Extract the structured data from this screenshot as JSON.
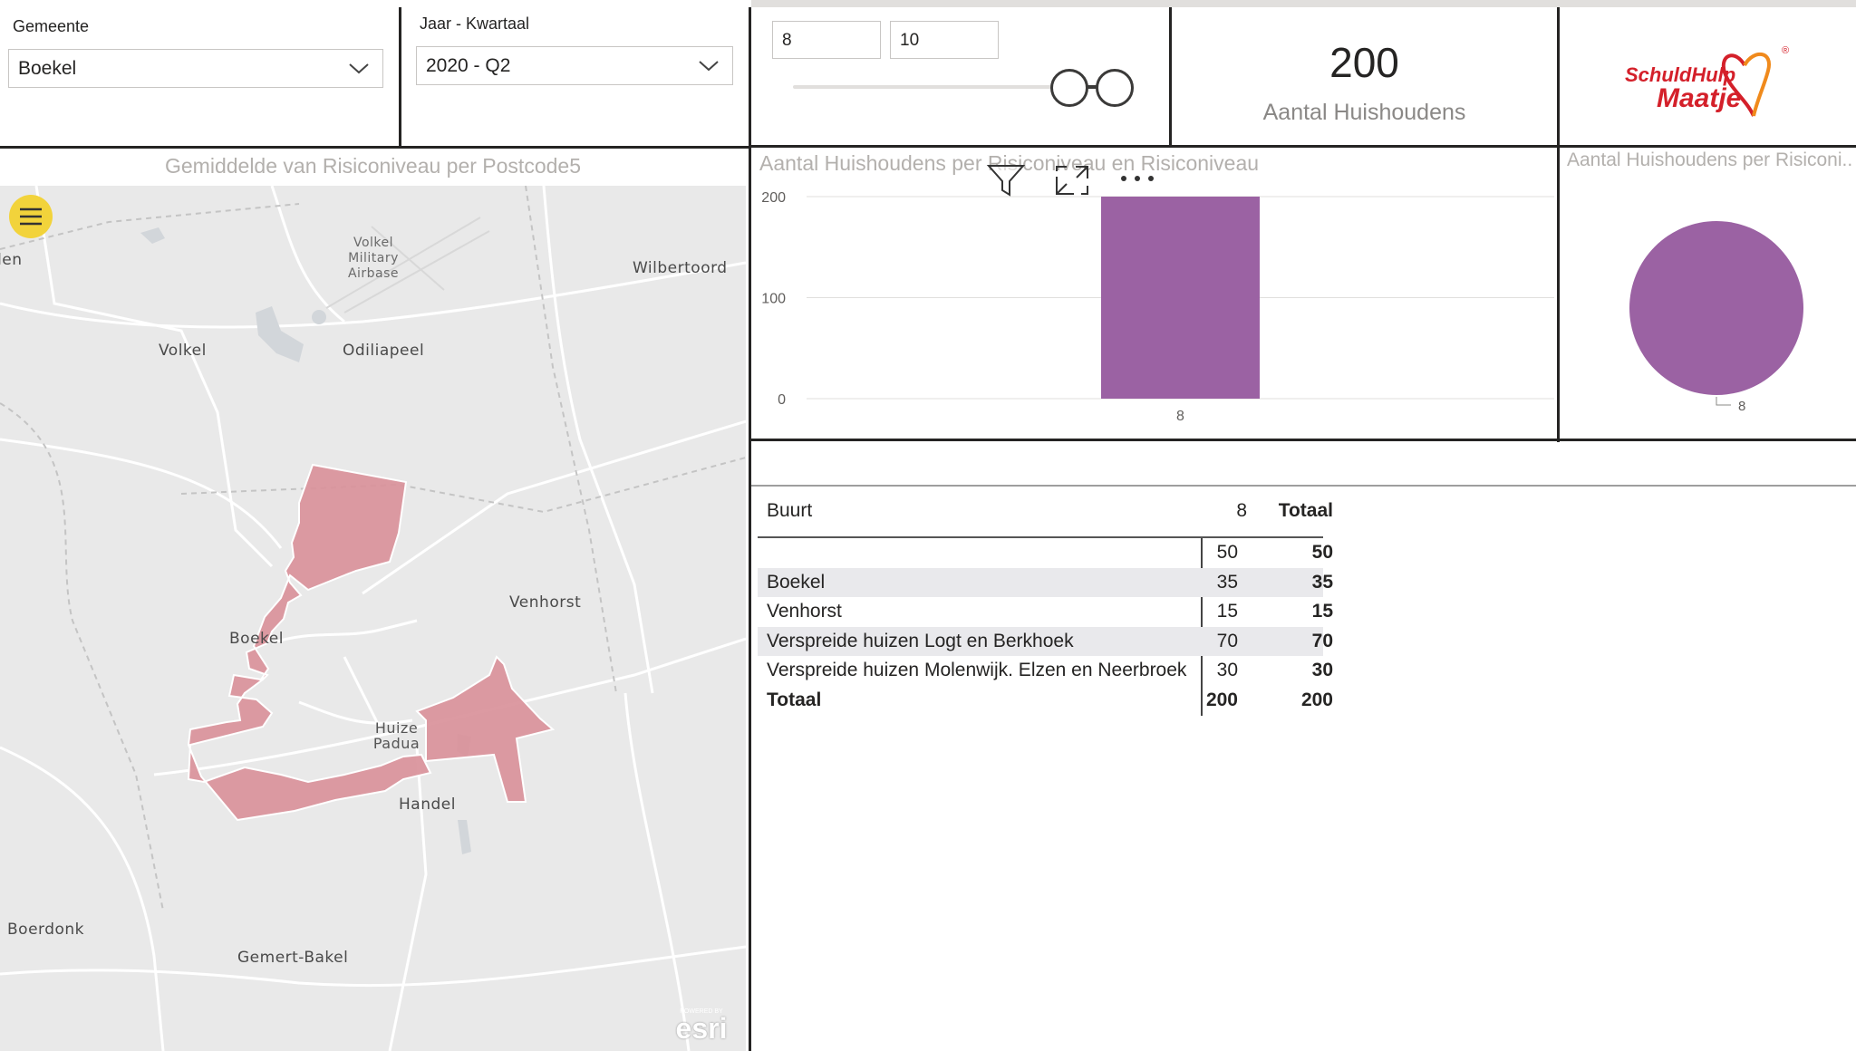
{
  "slicers": {
    "gemeente": {
      "label": "Gemeente",
      "value": "Boekel"
    },
    "jaar_kwartaal": {
      "label": "Jaar - Kwartaal",
      "value": "2020 - Q2"
    },
    "risico_range": {
      "min": "8",
      "max": "10",
      "lower_fraction": 0.85,
      "upper_fraction": 1.0
    }
  },
  "card": {
    "value": "200",
    "label": "Aantal Huishoudens"
  },
  "logo": {
    "line1": "SchuldHulp",
    "line2": "Maatje",
    "registered": "®",
    "color": "#d4202a",
    "accent": "#f08a1c"
  },
  "map_visual": {
    "title": "Gemiddelde van Risiconiveau per Postcode5",
    "menu_icon": "hamburger-icon",
    "attribution": "esri",
    "attribution_small": "POWERED BY",
    "region_color": "#d9919a",
    "places": {
      "uden": "Uden",
      "volkel_airbase": [
        "Volkel",
        "Military",
        "Airbase"
      ],
      "wilbertoord": "Wilbertoord",
      "volkel": "Volkel",
      "odiliapeel": "Odiliapeel",
      "venhorst": "Venhorst",
      "boekel": "Boekel",
      "huize_padua": [
        "Huize",
        "Padua"
      ],
      "handel": "Handel",
      "boerdonk": "Boerdonk",
      "gemert_bakel": "Gemert-Bakel"
    }
  },
  "bar_visual": {
    "title": "Aantal Huishoudens per Risiconiveau en Risiconiveau",
    "toolbar": {
      "filter_icon": "filter-icon",
      "focus_icon": "focus-mode-icon",
      "more_icon": "more-options-icon"
    }
  },
  "pie_visual": {
    "title": "Aantal Huishoudens per Risiconi...",
    "slice_label": "8",
    "color": "#9b62a3"
  },
  "chart_data": [
    {
      "type": "bar",
      "title": "Aantal Huishoudens per Risiconiveau en Risiconiveau",
      "categories": [
        "8"
      ],
      "values": [
        200
      ],
      "ylim": [
        0,
        200
      ],
      "yticks": [
        "0",
        "100",
        "200"
      ],
      "grid": true,
      "color": "#9b62a3"
    },
    {
      "type": "pie",
      "title": "Aantal Huishoudens per Risiconi...",
      "categories": [
        "8"
      ],
      "values": [
        200
      ],
      "color": "#9b62a3"
    }
  ],
  "table": {
    "headers": [
      "Buurt",
      "8",
      "Totaal"
    ],
    "rows": [
      {
        "buurt": "",
        "v8": "50",
        "totaal": "50"
      },
      {
        "buurt": "Boekel",
        "v8": "35",
        "totaal": "35"
      },
      {
        "buurt": "Venhorst",
        "v8": "15",
        "totaal": "15"
      },
      {
        "buurt": "Verspreide huizen Logt en Berkhoek",
        "v8": "70",
        "totaal": "70"
      },
      {
        "buurt": "Verspreide huizen Molenwijk. Elzen en Neerbroek",
        "v8": "30",
        "totaal": "30"
      }
    ],
    "total": {
      "buurt": "Totaal",
      "v8": "200",
      "totaal": "200"
    }
  }
}
